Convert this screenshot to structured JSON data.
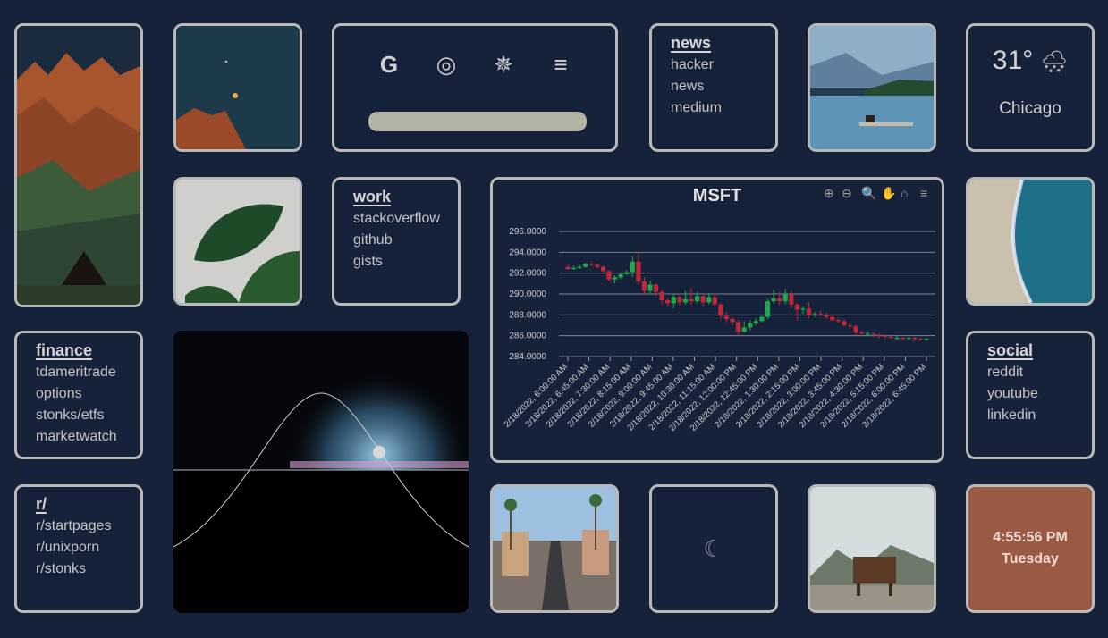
{
  "search": {
    "engines": [
      {
        "icon": "google-icon",
        "glyph": "G"
      },
      {
        "icon": "duckduckgo-icon",
        "glyph": "◎"
      },
      {
        "icon": "wolframalpha-icon",
        "glyph": "✵"
      },
      {
        "icon": "stackoverflow-icon",
        "glyph": "≡"
      }
    ],
    "placeholder": "",
    "bar_color": "#b4b3a5"
  },
  "news": {
    "title": "news",
    "links": [
      "hacker",
      "news",
      "medium"
    ]
  },
  "work": {
    "title": "work",
    "links": [
      "stackoverflow",
      "github",
      "gists"
    ]
  },
  "finance": {
    "title": "finance",
    "links": [
      "tdameritrade",
      "options",
      "stonks/etfs",
      "marketwatch"
    ]
  },
  "social": {
    "title": "social",
    "links": [
      "reddit",
      "youtube",
      "linkedin"
    ]
  },
  "reddit": {
    "title": "r/",
    "links": [
      "r/startpages",
      "r/unixporn",
      "r/stonks"
    ]
  },
  "weather": {
    "temp": "31°",
    "icon": "snow-cloud-icon",
    "city": "Chicago"
  },
  "clock": {
    "time": "4:55:56 PM",
    "day": "Tuesday",
    "bg_color": "#9b5a43"
  },
  "moon": {
    "icon": "crescent-moon-icon",
    "glyph": "☾"
  },
  "colors": {
    "background": "#16213a",
    "border": "#b9b9b9",
    "up": "#1fa84a",
    "down": "#c0283a"
  },
  "chart_data": {
    "type": "candlestick",
    "title": "MSFT",
    "toolbar": [
      "zoom-in-icon",
      "zoom-out-icon",
      "zoom-selection-icon",
      "pan-icon",
      "home-reset-icon",
      "menu-icon"
    ],
    "y_ticks": [
      "296.0000",
      "294.0000",
      "292.0000",
      "290.0000",
      "288.0000",
      "286.0000",
      "284.0000"
    ],
    "ylim": [
      284,
      296
    ],
    "x_ticks": [
      "2/18/2022, 6:00:00 AM",
      "2/18/2022, 6:45:00 AM",
      "2/18/2022, 7:30:00 AM",
      "2/18/2022, 8:15:00 AM",
      "2/18/2022, 9:00:00 AM",
      "2/18/2022, 9:45:00 AM",
      "2/18/2022, 10:30:00 AM",
      "2/18/2022, 11:15:00 AM",
      "2/18/2022, 12:00:00 PM",
      "2/18/2022, 12:45:00 PM",
      "2/18/2022, 1:30:00 PM",
      "2/18/2022, 2:15:00 PM",
      "2/18/2022, 3:00:00 PM",
      "2/18/2022, 3:45:00 PM",
      "2/18/2022, 4:30:00 PM",
      "2/18/2022, 5:15:00 PM",
      "2/18/2022, 6:00:00 PM",
      "2/18/2022, 6:45:00 PM"
    ],
    "candles": [
      [
        292.6,
        292.4,
        292.8,
        292.3
      ],
      [
        292.4,
        292.5,
        292.7,
        292.3
      ],
      [
        292.5,
        292.6,
        292.8,
        292.4
      ],
      [
        292.6,
        292.9,
        293.0,
        292.5
      ],
      [
        292.9,
        292.8,
        293.0,
        292.7
      ],
      [
        292.8,
        292.6,
        292.9,
        292.4
      ],
      [
        292.6,
        292.2,
        292.7,
        292.1
      ],
      [
        292.2,
        291.4,
        292.3,
        291.2
      ],
      [
        291.4,
        291.6,
        291.8,
        291.0
      ],
      [
        291.6,
        291.9,
        292.1,
        291.4
      ],
      [
        291.9,
        292.1,
        292.3,
        291.8
      ],
      [
        292.1,
        293.1,
        293.6,
        291.6
      ],
      [
        293.1,
        291.2,
        294.0,
        290.9
      ],
      [
        291.2,
        290.3,
        291.6,
        290.0
      ],
      [
        290.3,
        290.9,
        291.3,
        290.1
      ],
      [
        290.9,
        290.2,
        291.0,
        289.8
      ],
      [
        290.2,
        289.4,
        290.4,
        289.0
      ],
      [
        289.4,
        289.1,
        289.6,
        288.8
      ],
      [
        289.1,
        289.7,
        290.0,
        288.6
      ],
      [
        289.7,
        289.2,
        289.9,
        288.9
      ],
      [
        289.2,
        289.5,
        290.3,
        289.0
      ],
      [
        289.5,
        289.3,
        290.6,
        289.0
      ],
      [
        289.3,
        289.8,
        290.2,
        289.1
      ],
      [
        289.8,
        289.2,
        290.0,
        288.8
      ],
      [
        289.2,
        289.7,
        290.1,
        289.0
      ],
      [
        289.7,
        289.0,
        289.9,
        288.7
      ],
      [
        289.0,
        287.9,
        289.2,
        287.6
      ],
      [
        287.9,
        287.6,
        288.3,
        287.3
      ],
      [
        287.6,
        287.3,
        287.8,
        287.0
      ],
      [
        287.3,
        286.4,
        287.5,
        286.0
      ],
      [
        286.4,
        286.8,
        287.4,
        286.3
      ],
      [
        286.8,
        287.2,
        287.5,
        286.5
      ],
      [
        287.2,
        287.4,
        287.7,
        287.0
      ],
      [
        287.4,
        287.8,
        288.0,
        287.3
      ],
      [
        287.8,
        289.3,
        289.5,
        287.6
      ],
      [
        289.3,
        289.6,
        290.4,
        289.1
      ],
      [
        289.6,
        289.3,
        290.2,
        288.9
      ],
      [
        289.3,
        290.0,
        290.5,
        289.0
      ],
      [
        290.0,
        289.0,
        290.3,
        288.6
      ],
      [
        289.0,
        288.5,
        289.1,
        287.5
      ],
      [
        288.5,
        288.6,
        288.8,
        288.1
      ],
      [
        288.6,
        288.0,
        289.2,
        287.7
      ],
      [
        288.0,
        288.1,
        288.3,
        287.8
      ],
      [
        288.1,
        288.0,
        288.4,
        287.8
      ],
      [
        288.0,
        287.8,
        288.2,
        287.6
      ],
      [
        287.8,
        287.5,
        288.0,
        287.4
      ],
      [
        287.5,
        287.4,
        287.7,
        287.2
      ],
      [
        287.4,
        287.0,
        287.6,
        286.9
      ],
      [
        287.0,
        286.9,
        287.2,
        286.7
      ],
      [
        286.9,
        286.3,
        287.0,
        286.1
      ],
      [
        286.3,
        286.2,
        286.5,
        286.0
      ],
      [
        286.2,
        286.2,
        286.4,
        286.0
      ],
      [
        286.2,
        286.1,
        286.3,
        285.9
      ],
      [
        286.1,
        286.0,
        286.2,
        285.8
      ],
      [
        286.0,
        285.9,
        286.1,
        285.7
      ],
      [
        285.9,
        285.8,
        286.0,
        285.7
      ],
      [
        285.8,
        285.8,
        286.0,
        285.6
      ],
      [
        285.8,
        285.7,
        285.9,
        285.6
      ],
      [
        285.7,
        285.8,
        285.9,
        285.6
      ],
      [
        285.8,
        285.7,
        285.9,
        285.5
      ],
      [
        285.7,
        285.6,
        285.8,
        285.5
      ],
      [
        285.6,
        285.7,
        285.8,
        285.5
      ]
    ]
  }
}
